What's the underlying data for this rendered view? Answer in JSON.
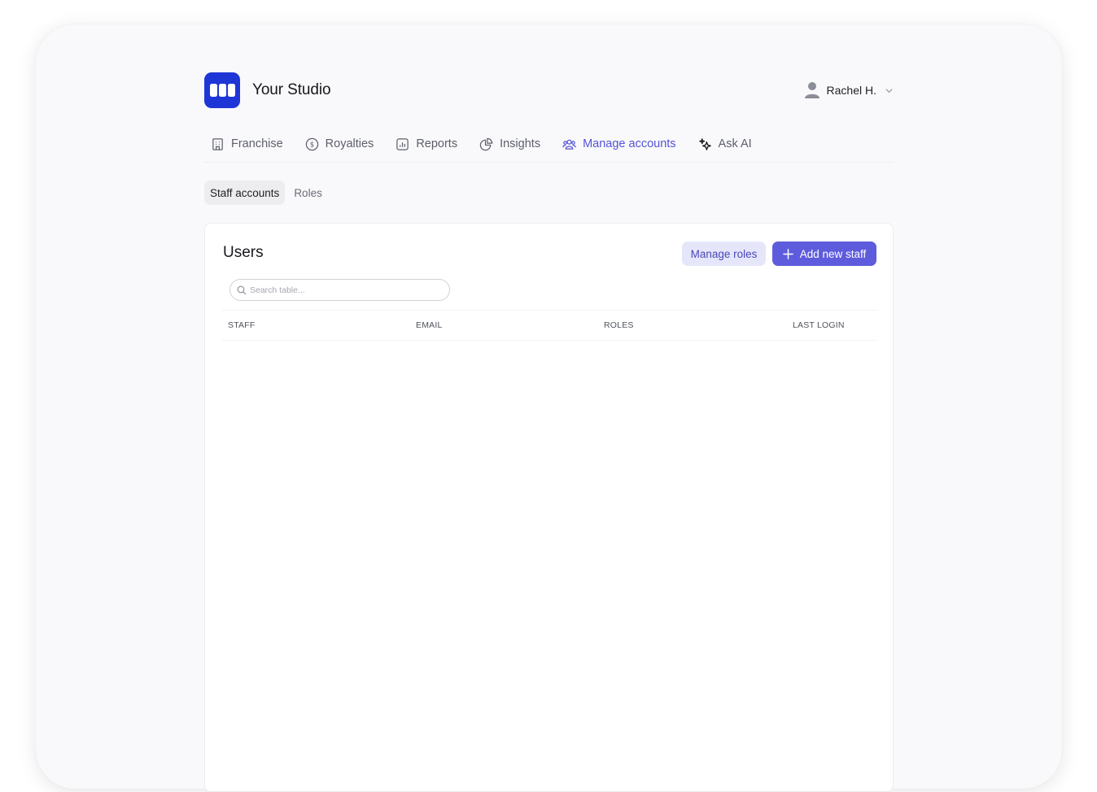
{
  "brand": {
    "name": "Your Studio",
    "color": "#1e36d6"
  },
  "user": {
    "name": "Rachel H."
  },
  "nav": {
    "items": [
      {
        "label": "Franchise",
        "icon": "building-icon",
        "active": false
      },
      {
        "label": "Royalties",
        "icon": "dollar-circle-icon",
        "active": false
      },
      {
        "label": "Reports",
        "icon": "bar-chart-icon",
        "active": false
      },
      {
        "label": "Insights",
        "icon": "pie-chart-icon",
        "active": false
      },
      {
        "label": "Manage accounts",
        "icon": "users-icon",
        "active": true
      },
      {
        "label": "Ask AI",
        "icon": "sparkles-icon",
        "active": false
      }
    ],
    "accent": "#5553d6"
  },
  "subtabs": [
    {
      "label": "Staff accounts",
      "active": true
    },
    {
      "label": "Roles",
      "active": false
    }
  ],
  "card": {
    "title": "Users",
    "manage_roles_label": "Manage roles",
    "add_staff_label": "Add new staff",
    "search_placeholder": "Search table...",
    "columns": [
      "STAFF",
      "EMAIL",
      "ROLES",
      "LAST LOGIN"
    ],
    "rows": []
  }
}
